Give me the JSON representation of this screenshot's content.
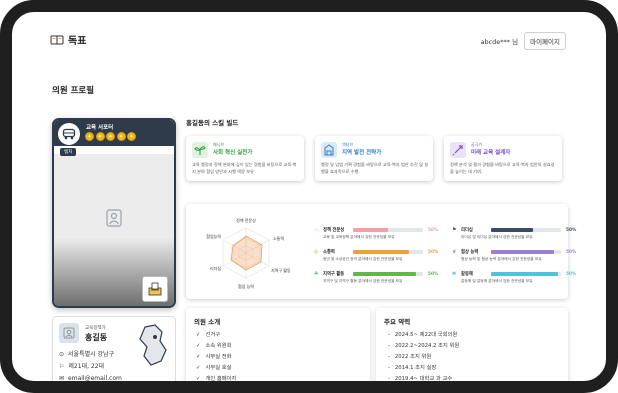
{
  "header": {
    "logo_text": "독표",
    "user_name": "abcde*** 님",
    "mypage_label": "마이페이지"
  },
  "page": {
    "title": "의원 프로필"
  },
  "card": {
    "category": "교육 서포터",
    "badge": "멤치",
    "coins": [
      "✦",
      "✦",
      "✦",
      "✦",
      "✦"
    ]
  },
  "profile": {
    "role": "교육정책가",
    "name": "홍길동",
    "location": "서울특별시 강남구",
    "term": "제21대, 22대",
    "email": "email@email.com"
  },
  "skills": {
    "title": "홍길동의 스킬 빌드",
    "items": [
      {
        "small": "패시브",
        "name": "사회 혁신 실천가",
        "desc": "교육 행정과 정책 분야에 깊이 있는 경험을 바탕으로 교육·복지 분야 협업 방안과 시행 역량 보유",
        "color": "#2e9b3a",
        "bg": "#dff2df"
      },
      {
        "small": "액티브",
        "name": "지역 발전 전략가",
        "desc": "행정 및 입법 기획 경험을 바탕으로 교육·복지 법안 추진 및 실행을 효과적으로 수행.",
        "color": "#2f7ad1",
        "bg": "#dde9f8"
      },
      {
        "small": "궁극기",
        "name": "미래 교육 설계자",
        "desc": "정책 분석 및 평가 경험을 바탕으로 교육·복지 법안의 실효성을 높이는 데 기여.",
        "color": "#7b48c8",
        "bg": "#ece2f8"
      }
    ]
  },
  "radar": {
    "labels": [
      "정책 전문성",
      "소통력",
      "지역구 활동",
      "협업 능력",
      "리더십",
      "협업능력"
    ]
  },
  "metrics": [
    {
      "icon": "▭",
      "name": "정책 전문성",
      "pct": "50%",
      "value": 0.5,
      "color": "#f0a0ab",
      "desc": "교육 및 교육정책 분야에서 강한 전문성을 보유"
    },
    {
      "icon": "◎",
      "name": "소통력",
      "pct": "50%",
      "value": 0.8,
      "color": "#f0a23a",
      "desc": "청년 및 소상공인 등의 분야에서 강한 전문성을 보유"
    },
    {
      "icon": "☘",
      "name": "지역구 활동",
      "pct": "50%",
      "value": 0.9,
      "color": "#5fb84a",
      "desc": "지역구 및 지역구 활동 분야에서 강한 전문성을 보유"
    },
    {
      "icon": "⚑",
      "name": "리더십",
      "pct": "50%",
      "value": 0.6,
      "color": "#3e4c63",
      "desc": "리더십 및 리더십 분야에서 강한 전문성을 보유"
    },
    {
      "icon": "♛",
      "name": "협상 능력",
      "pct": "50%",
      "value": 0.9,
      "color": "#9b7fd0",
      "desc": "협상 능력 및 협상 능력 분야에서 강한 전문성을 보유"
    },
    {
      "icon": "✺",
      "name": "갈등해",
      "pct": "50%",
      "value": 0.95,
      "color": "#4fc3dc",
      "desc": "갈등해 및 갈등해 분야에서 강한 전문성을 보유"
    }
  ],
  "intro": {
    "title": "의원 소개",
    "items": [
      "선거구",
      "소속 위원회",
      "사무실 전화",
      "사무실 호실",
      "개인 홈페이지"
    ]
  },
  "history": {
    "title": "주요 약력",
    "items": [
      "2024.5~ 제22대 국회의원",
      "2022.2~2024.2 조지 위원",
      "2022 조지 위원",
      "2014.1 조지 실장",
      "2019.4~ 대학교 과 교수"
    ]
  }
}
